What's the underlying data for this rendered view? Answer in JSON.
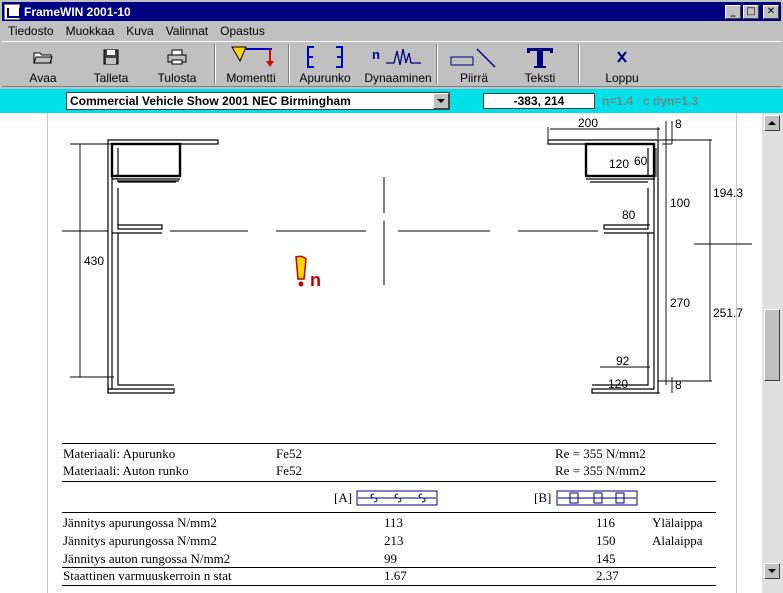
{
  "window": {
    "title": "FrameWIN 2001-10"
  },
  "menu": [
    "Tiedosto",
    "Muokkaa",
    "Kuva",
    "Valinnat",
    "Opastus"
  ],
  "toolbar": {
    "avaa": "Avaa",
    "talleta": "Talleta",
    "tulosta": "Tulosta",
    "momentti": "Momentti",
    "apurunko": "Apurunko",
    "dynaaminen": "Dynaaminen",
    "piirra": "Piirrä",
    "teksti": "Teksti",
    "loppu": "Loppu"
  },
  "infobar": {
    "project": "Commercial Vehicle Show 2001 NEC Birmingham",
    "coords": "-383, 214",
    "n": "n=1.4",
    "cdyn": "c dyn=1.3"
  },
  "drawing": {
    "left_height": "430",
    "dim_200": "200",
    "dim_8_top": "8",
    "dim_120_top": "120",
    "dim_60": "60",
    "dim_100": "100",
    "dim_80": "80",
    "dim_270": "270",
    "dim_92": "92",
    "dim_120_bottom": "120",
    "dim_8_bottom": "8",
    "dim_194": "194.3",
    "dim_251": "251.7",
    "warning_icon": "warning-icon"
  },
  "materials": [
    {
      "label": "Materiaali:  Apurunko",
      "grade": "Fe52",
      "re": "Re = 355 N/mm2"
    },
    {
      "label": "Materiaali:  Auton runko",
      "grade": "Fe52",
      "re": "Re = 355 N/mm2"
    }
  ],
  "section_a": "[A]",
  "section_b": "[B]",
  "results": [
    {
      "label": "Jännitys apurungossa  N/mm2",
      "a": "113",
      "b": "116",
      "note": "Ylälaippa"
    },
    {
      "label": "Jännitys apurungossa  N/mm2",
      "a": "213",
      "b": "150",
      "note": "Alalaippa"
    },
    {
      "label": "Jännitys auton rungossa  N/mm2",
      "a": "99",
      "b": "145",
      "note": ""
    },
    {
      "label": "Staattinen varmuuskerroin n stat",
      "a": "1.67",
      "b": "2.37",
      "note": ""
    }
  ]
}
